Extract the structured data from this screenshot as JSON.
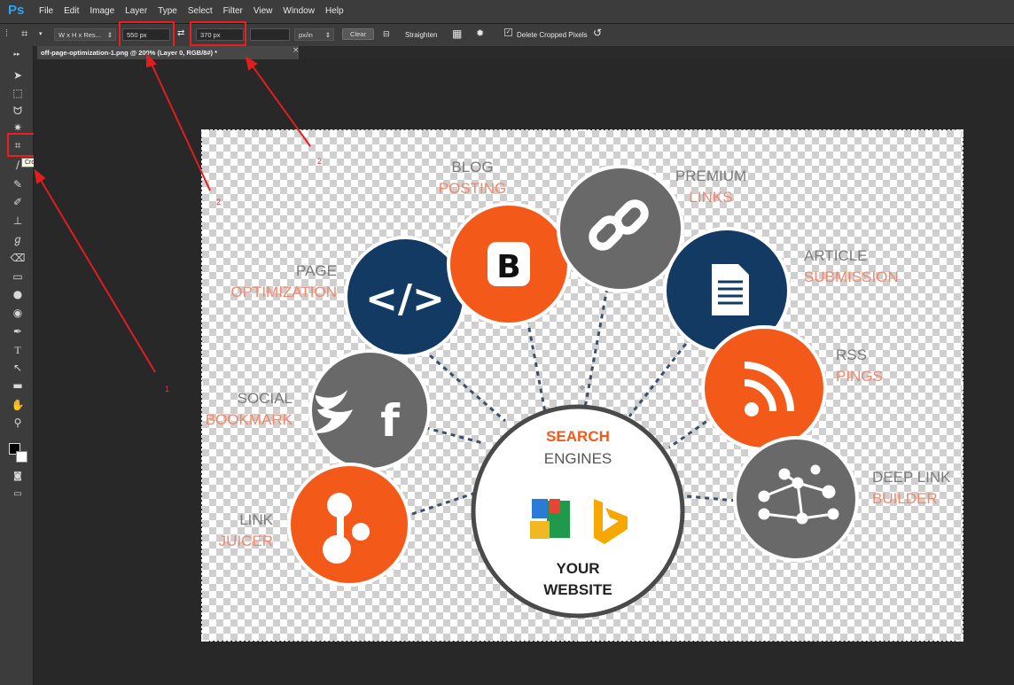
{
  "app": {
    "logo": "Ps"
  },
  "menu": [
    "File",
    "Edit",
    "Image",
    "Layer",
    "Type",
    "Select",
    "Filter",
    "View",
    "Window",
    "Help"
  ],
  "options": {
    "ratio_select": "W x H x Res...",
    "width_value": "550 px",
    "height_value": "370 px",
    "resolution_value": "",
    "resolution_unit": "px/in",
    "clear_label": "Clear",
    "straighten_label": "Straighten",
    "delete_cropped_label": "Delete Cropped Pixels",
    "delete_cropped_checked": true
  },
  "document_tab": {
    "title": "off-page-optimization-1.png @ 200% (Layer 0, RGB/8#) *",
    "close": "×"
  },
  "tooltip": "Crop Tool (C)",
  "annotations": {
    "one": "1",
    "two_a": "2",
    "two_b": "2"
  },
  "image": {
    "blog": [
      "BLOG",
      "POSTING"
    ],
    "premium": [
      "PREMIUM",
      "LINKS"
    ],
    "article": [
      "ARTICLE",
      "SUBMISSION"
    ],
    "page": [
      "PAGE",
      "OPTIMIZATION"
    ],
    "rss": [
      "RSS",
      "PINGS"
    ],
    "social": [
      "SOCIAL",
      "BOOKMARK"
    ],
    "deeplink": [
      "DEEP LINK",
      "BUILDER"
    ],
    "link": [
      "LINK",
      "JUICER"
    ],
    "center": [
      "SEARCH",
      "ENGINES",
      "YOUR",
      "WEBSITE"
    ],
    "code_symbol": "</>",
    "blogger_letter": "B",
    "facebook_letter": "f",
    "colors": {
      "orange": "#f35a1a",
      "navy": "#123a63",
      "gray": "#696969",
      "label_gray": "#7a7a7a",
      "label_orange": "#f4876a"
    }
  }
}
